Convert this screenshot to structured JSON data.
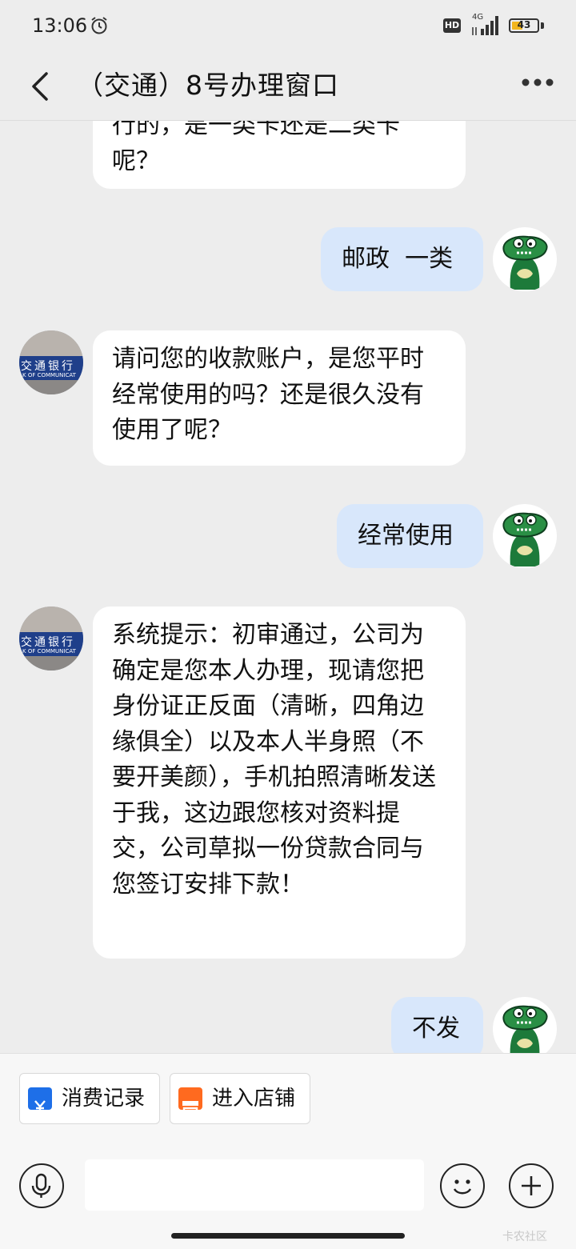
{
  "status_bar": {
    "time": "13:06",
    "network_type": "4G",
    "hd_label": "HD",
    "battery_level": "43",
    "battery_fraction": 0.43,
    "icons": [
      "alarm-icon",
      "hd-icon",
      "signal-icon",
      "battery-icon"
    ]
  },
  "header": {
    "title": "（交通）8号办理窗口",
    "back_icon": "chevron-left-icon",
    "more_icon": "more-dots-icon"
  },
  "messages": [
    {
      "direction": "incoming",
      "text": "行的，是一类卡还是二类卡呢？"
    },
    {
      "direction": "outgoing",
      "text": "邮政  一类"
    },
    {
      "direction": "incoming",
      "text": "请问您的收款账户，是您平时经常使用的吗？还是很久没有使用了呢？"
    },
    {
      "direction": "outgoing",
      "text": "经常使用"
    },
    {
      "direction": "incoming",
      "text": "系统提示：初审通过，公司为确定是您本人办理，现请您把身份证正反面（清晰，四角边缘俱全）以及本人半身照（不要开美颜），手机拍照清晰发送于我，这边跟您核对资料提交，公司草拟一份贷款合同与您签订安排下款！"
    },
    {
      "direction": "outgoing",
      "text": "不发"
    }
  ],
  "bank_avatar": {
    "text": "交通银行",
    "sub": "K OF COMMUNICAT"
  },
  "quick_actions": [
    {
      "label": "消费记录",
      "icon": "yuan-receipt-icon",
      "color": "#1e6fe8"
    },
    {
      "label": "进入店铺",
      "icon": "store-icon",
      "color": "#ff6a1f"
    }
  ],
  "input_bar": {
    "voice_icon": "microphone-icon",
    "emoji_icon": "smiley-icon",
    "plus_icon": "plus-icon"
  },
  "watermark": "卡农社区"
}
